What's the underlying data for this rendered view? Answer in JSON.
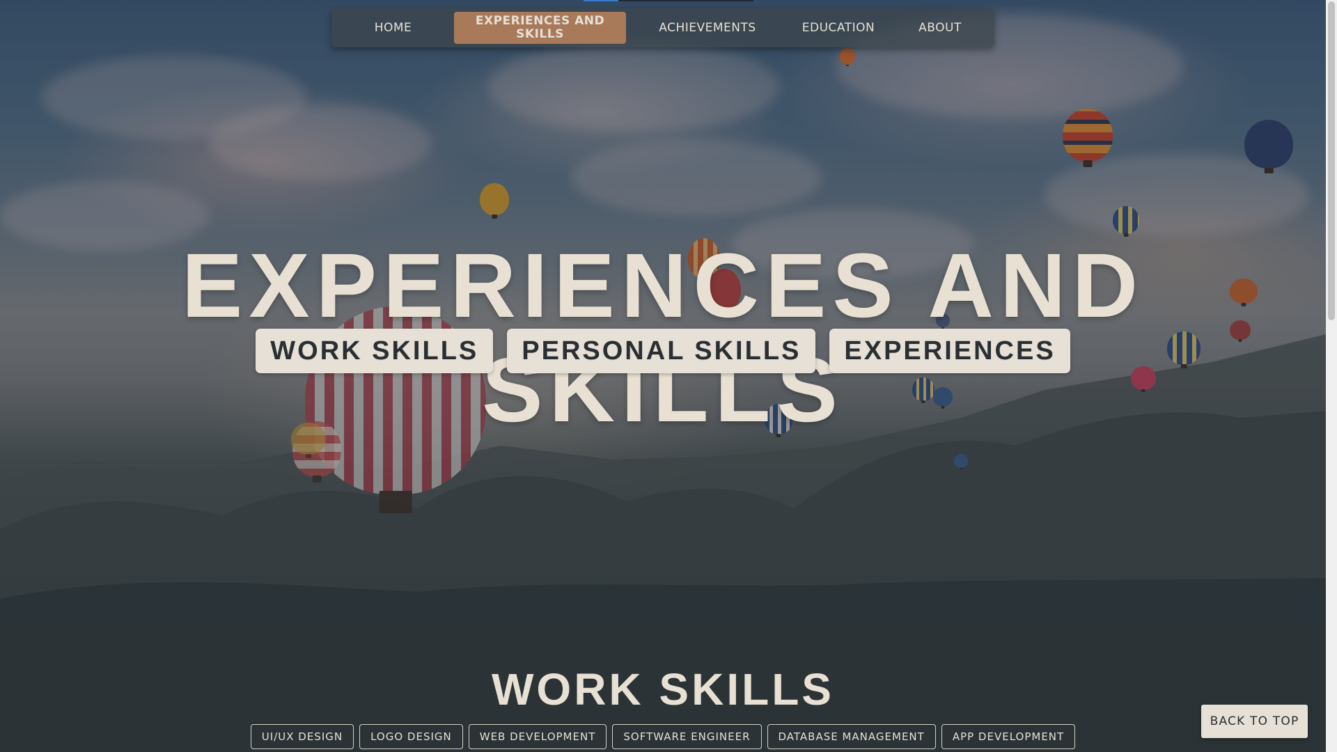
{
  "nav": {
    "items": [
      {
        "label": "HOME"
      },
      {
        "label": "EXPERIENCES AND SKILLS"
      },
      {
        "label": "ACHIEVEMENTS"
      },
      {
        "label": "EDUCATION"
      },
      {
        "label": "ABOUT"
      }
    ],
    "active_index": 1
  },
  "hero": {
    "title": "EXPERIENCES AND SKILLS",
    "buttons": [
      {
        "label": "WORK SKILLS"
      },
      {
        "label": "PERSONAL SKILLS"
      },
      {
        "label": "EXPERIENCES"
      }
    ],
    "background": "hot-air-balloons-over-valley-photo"
  },
  "work_skills": {
    "title": "WORK SKILLS",
    "tags": [
      {
        "label": "UI/UX DESIGN"
      },
      {
        "label": "LOGO DESIGN"
      },
      {
        "label": "WEB DEVELOPMENT"
      },
      {
        "label": "SOFTWARE ENGINEER"
      },
      {
        "label": "DATABASE MANAGEMENT"
      },
      {
        "label": "APP DEVELOPMENT"
      }
    ]
  },
  "back_to_top": {
    "label": "BACK TO TOP"
  },
  "colors": {
    "page_bg": "#2b3336",
    "accent": "#a87a5a",
    "cream": "#e6e0d6",
    "navbar_bg": "#3c464c"
  }
}
